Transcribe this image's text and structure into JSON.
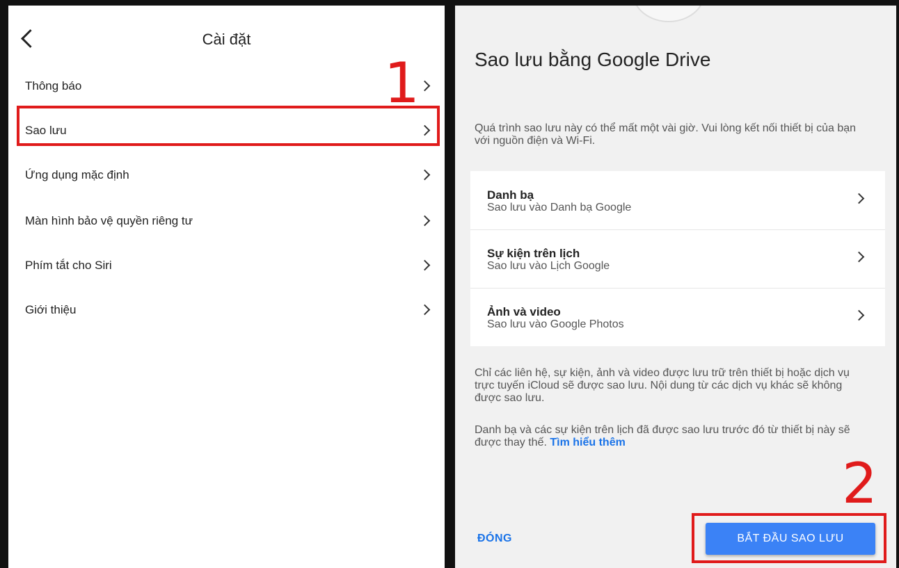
{
  "left": {
    "header_title": "Cài đặt",
    "menu": [
      {
        "label": "Thông báo"
      },
      {
        "label": "Sao lưu"
      },
      {
        "label": "Ứng dụng mặc định"
      },
      {
        "label": "Màn hình bảo vệ quyền riêng tư"
      },
      {
        "label": "Phím tắt cho Siri"
      },
      {
        "label": "Giới thiệu"
      }
    ],
    "step_number": "1"
  },
  "right": {
    "title": "Sao lưu bằng Google Drive",
    "intro": "Quá trình sao lưu này có thể mất một vài giờ. Vui lòng kết nối thiết bị của bạn với nguồn điện và Wi-Fi.",
    "items": [
      {
        "title": "Danh bạ",
        "subtitle": "Sao lưu vào Danh bạ Google"
      },
      {
        "title": "Sự kiện trên lịch",
        "subtitle": "Sao lưu vào Lịch Google"
      },
      {
        "title": "Ảnh và video",
        "subtitle": "Sao lưu vào Google Photos"
      }
    ],
    "note1": "Chỉ các liên hệ, sự kiện, ảnh và video được lưu trữ trên thiết bị hoặc dịch vụ trực tuyến iCloud sẽ được sao lưu. Nội dung từ các dịch vụ khác sẽ không được sao lưu.",
    "note2": "Danh bạ và các sự kiện trên lịch đã được sao lưu trước đó từ thiết bị này sẽ được thay thế.",
    "learn_more": "Tìm hiểu thêm",
    "close_label": "ĐÓNG",
    "start_label": "BẮT ĐẦU SAO LƯU",
    "step_number": "2"
  },
  "colors": {
    "highlight": "#e01b1b",
    "link": "#1a73e8",
    "button": "#3b82f6"
  }
}
